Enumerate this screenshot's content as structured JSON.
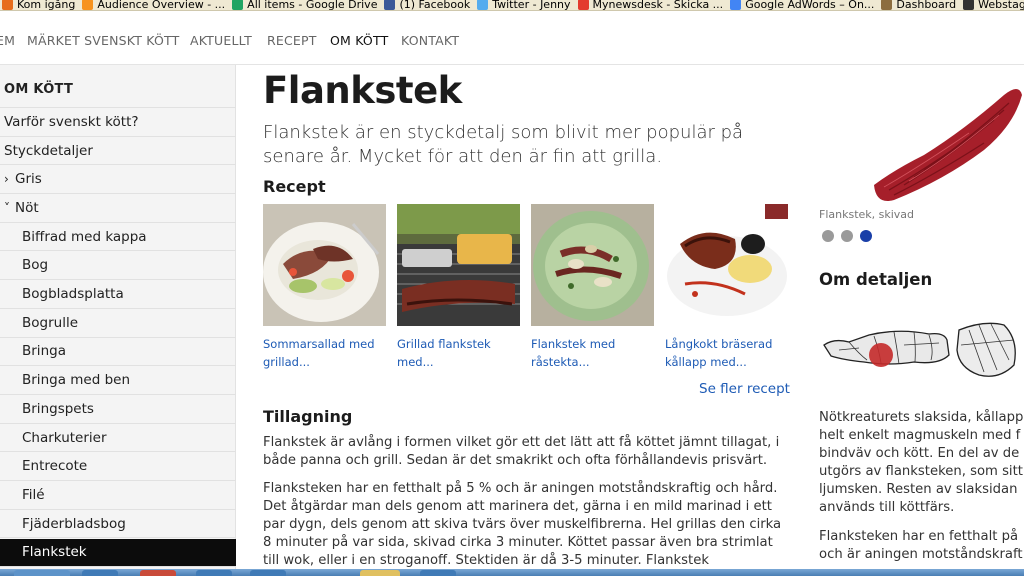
{
  "bookmarks": [
    {
      "label": "Kom igång",
      "icon": "firefox-icon",
      "color": "#e76d1b"
    },
    {
      "label": "Audience Overview - ...",
      "icon": "analytics-icon",
      "color": "#f7931e"
    },
    {
      "label": "All items - Google Drive",
      "icon": "google-drive-icon",
      "color": "#1fa463"
    },
    {
      "label": "(1) Facebook",
      "icon": "facebook-icon",
      "color": "#3b5998"
    },
    {
      "label": "Twitter - Jenny",
      "icon": "twitter-icon",
      "color": "#55acee"
    },
    {
      "label": "Mynewsdesk - Skicka ...",
      "icon": "mynewsdesk-icon",
      "color": "#e33b2e"
    },
    {
      "label": "Google AdWords – On...",
      "icon": "google-icon",
      "color": "#4285f4"
    },
    {
      "label": "Dashboard",
      "icon": "dashboard-icon",
      "color": "#8c6d3f"
    },
    {
      "label": "Webstagram - the b",
      "icon": "webstagram-icon",
      "color": "#333333"
    }
  ],
  "nav": {
    "items": [
      "EM",
      "MÄRKET SVENSKT KÖTT",
      "AKTUELLT",
      "RECEPT",
      "OM KÖTT",
      "KONTAKT"
    ],
    "active": "OM KÖTT"
  },
  "sidebar": {
    "heading": "OM KÖTT",
    "items": [
      {
        "label": "Varför svenskt kött?",
        "level": 0
      },
      {
        "label": "Styckdetaljer",
        "level": 0
      },
      {
        "label": "Gris",
        "level": 1,
        "chevron": "›"
      },
      {
        "label": "Nöt",
        "level": 1,
        "chevron": "˅"
      },
      {
        "label": "Biffrad med kappa",
        "level": 2
      },
      {
        "label": "Bog",
        "level": 2
      },
      {
        "label": "Bogbladsplatta",
        "level": 2
      },
      {
        "label": "Bogrulle",
        "level": 2
      },
      {
        "label": "Bringa",
        "level": 2
      },
      {
        "label": "Bringa med ben",
        "level": 2
      },
      {
        "label": "Bringspets",
        "level": 2
      },
      {
        "label": "Charkuterier",
        "level": 2
      },
      {
        "label": "Entrecote",
        "level": 2
      },
      {
        "label": "Filé",
        "level": 2
      },
      {
        "label": "Fjäderbladsbog",
        "level": 2
      },
      {
        "label": "Flankstek",
        "level": 2,
        "active": true
      }
    ]
  },
  "main": {
    "title": "Flankstek",
    "intro": "Flankstek är en styckdetalj som blivit mer populär på senare år. Mycket för att den är fin att grilla.",
    "recipes_heading": "Recept",
    "recipes": [
      {
        "line1": "Sommarsallad med",
        "line2": "grillad..."
      },
      {
        "line1": "Grillad flankstek",
        "line2": "med..."
      },
      {
        "line1": "Flankstek med",
        "line2": "råstekta..."
      },
      {
        "line1": "Långkokt bräserad",
        "line2": "kållapp med..."
      }
    ],
    "more_recipes": "Se fler recept",
    "preparation_heading": "Tillagning",
    "paragraph1": "Flankstek är avlång i formen vilket gör ett det lätt att få köttet jämnt tillagat, i både panna och grill. Sedan är det smakrikt och ofta förhållandevis prisvärt.",
    "paragraph2": "Flanksteken har en fetthalt på 5 % och är aningen motståndskraftig och hård. Det åtgärdar man dels genom att marinera det, gärna i en mild marinad i ett par dygn, dels genom att skiva tvärs över muskelfibrerna. Hel grillas den cirka 8 minuter på var sida, skivad cirka 3 minuter. Köttet passar även bra strimlat till wok, eller i en stroganoff. Stektiden är då 3-5 minuter. Flankstek"
  },
  "detail": {
    "image_caption": "Flankstek, skivad",
    "carousel_dots": 3,
    "carousel_active": 3,
    "heading": "Om detaljen",
    "paragraph1_lines": [
      "Nötkreaturets slaksida, kållapp",
      "helt enkelt magmuskeln med f",
      "bindväv och kött. En del av de",
      "utgörs av flanksteken, som sitt",
      "ljumsken. Resten av slaksidan",
      "används till köttfärs."
    ],
    "paragraph2_lines": [
      "Flanksteken har en fetthalt på",
      "och är aningen motståndskraft"
    ]
  },
  "colors": {
    "link": "#1e5bb5",
    "active_sidebar": "#0c0c0c",
    "carousel_active": "#1a3fa8",
    "highlight_cut": "#c42a2a"
  }
}
